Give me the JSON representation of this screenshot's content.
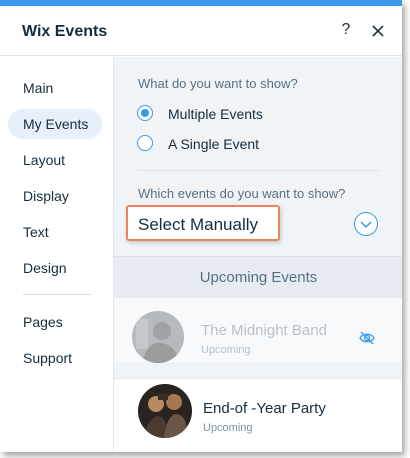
{
  "header": {
    "title": "Wix Events",
    "help_label": "?",
    "close_icon": "close-icon"
  },
  "sidebar": {
    "items": [
      {
        "label": "Main",
        "active": false
      },
      {
        "label": "My Events",
        "active": true
      },
      {
        "label": "Layout",
        "active": false
      },
      {
        "label": "Display",
        "active": false
      },
      {
        "label": "Text",
        "active": false
      },
      {
        "label": "Design",
        "active": false
      },
      {
        "label": "Pages",
        "active": false
      },
      {
        "label": "Support",
        "active": false
      }
    ]
  },
  "content": {
    "show_question": "What do you want to show?",
    "show_options": [
      {
        "label": "Multiple Events",
        "checked": true
      },
      {
        "label": "A Single Event",
        "checked": false
      }
    ],
    "which_question": "Which events do you want to show?",
    "selection_mode": "Select Manually",
    "dropdown_icon": "chevron-down-icon",
    "tab_label": "Upcoming Events",
    "events": [
      {
        "name": "The Midnight Band",
        "status": "Upcoming",
        "hidden": true
      },
      {
        "name": "End-of -Year Party",
        "status": "Upcoming",
        "hidden": false
      }
    ]
  },
  "colors": {
    "accent": "#3899ec",
    "highlight_border": "#e8855d",
    "active_nav_bg": "#e7f0fa",
    "content_bg": "#f0f4f7"
  }
}
